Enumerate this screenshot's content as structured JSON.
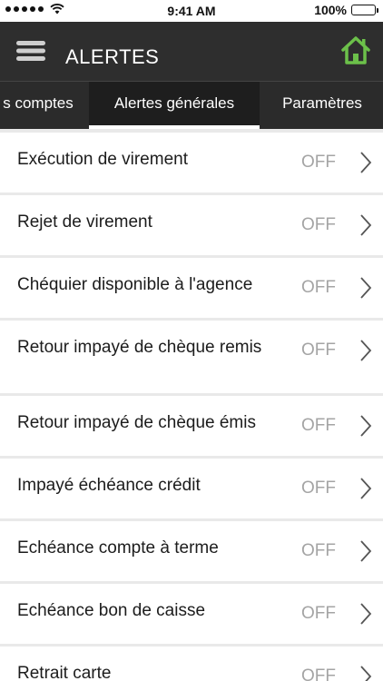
{
  "status_bar": {
    "signal_dots": 5,
    "time": "9:41 AM",
    "battery_percent": "100%"
  },
  "header": {
    "title": "ALERTES",
    "menu_icon": "hamburger-menu-icon",
    "home_icon": "home-icon",
    "home_icon_color": "#6cc04a"
  },
  "tabs": [
    {
      "label": "s comptes",
      "active": false
    },
    {
      "label": "Alertes générales",
      "active": true
    },
    {
      "label": "Paramètres",
      "active": false
    }
  ],
  "alerts": [
    {
      "label": "Exécution de virement",
      "status": "OFF"
    },
    {
      "label": "Rejet de virement",
      "status": "OFF"
    },
    {
      "label": "Chéquier disponible à l'agence",
      "status": "OFF"
    },
    {
      "label": "Retour impayé de chèque remis",
      "status": "OFF"
    },
    {
      "label": "Retour impayé de chèque émis",
      "status": "OFF"
    },
    {
      "label": "Impayé échéance crédit",
      "status": "OFF"
    },
    {
      "label": "Echéance compte à terme",
      "status": "OFF"
    },
    {
      "label": "Echéance bon de caisse",
      "status": "OFF"
    },
    {
      "label": "Retrait carte",
      "status": "OFF"
    }
  ],
  "colors": {
    "header_bg": "#2e2e2e",
    "tab_active_bg": "#1e1e1e",
    "list_separator": "#e9e9e9",
    "status_off": "#a4a4a4"
  }
}
